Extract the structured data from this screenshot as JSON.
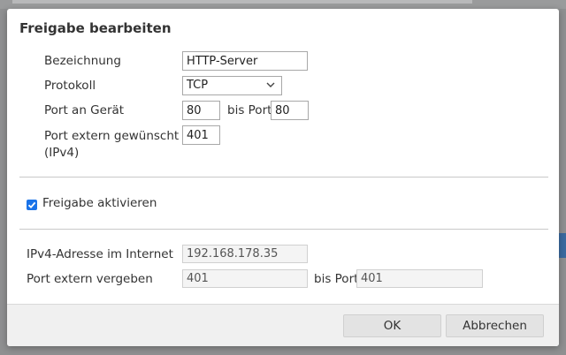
{
  "dialog": {
    "title": "Freigabe bearbeiten",
    "bezeichnung_label": "Bezeichnung",
    "bezeichnung_value": "HTTP-Server",
    "protokoll_label": "Protokoll",
    "protokoll_value": "TCP",
    "port_geraet_label": "Port an Gerät",
    "port_geraet_from": "80",
    "bis_port_label": "bis Port",
    "port_geraet_to": "80",
    "port_extern_label_line1": "Port extern gewünscht",
    "port_extern_label_line2": "(IPv4)",
    "port_extern_value": "401",
    "freigabe_label": "Freigabe aktivieren",
    "freigabe_checked": true,
    "ipv4_label": "IPv4-Adresse im Internet",
    "ipv4_value": "192.168.178.35",
    "port_vergeben_label": "Port extern vergeben",
    "port_vergeben_from": "401",
    "port_vergeben_bis_label": "bis Port",
    "port_vergeben_to": "401",
    "ok_label": "OK",
    "cancel_label": "Abbrechen"
  },
  "colors": {
    "checkbox": "#1a73e8",
    "footer": "#f0f0f0",
    "button": "#e3e3e3"
  },
  "icons": {
    "protokoll_dropdown": "chevron-down-icon",
    "checkbox": "checkmark-icon"
  }
}
